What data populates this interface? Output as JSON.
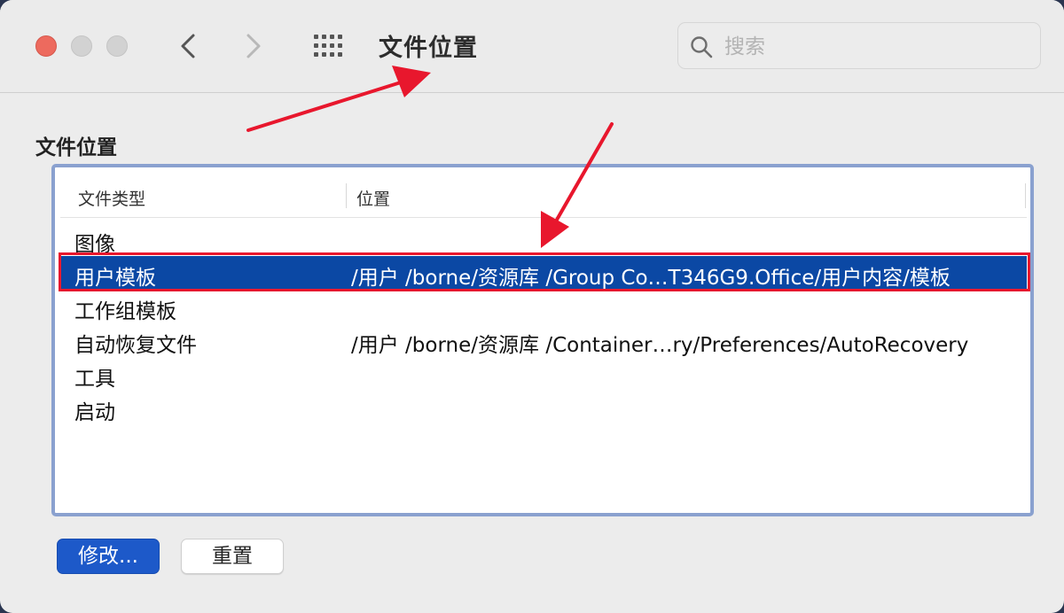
{
  "window": {
    "title": "文件位置"
  },
  "toolbar": {
    "back_icon": "chevron-left-icon",
    "forward_icon": "chevron-right-icon",
    "grid_icon": "show-all-grid-icon"
  },
  "search": {
    "placeholder": "搜索",
    "value": ""
  },
  "section": {
    "label": "文件位置"
  },
  "table": {
    "columns": [
      "文件类型",
      "位置"
    ],
    "rows": [
      {
        "type": "图像",
        "location": ""
      },
      {
        "type": "用户模板",
        "location": "/用户 /borne/资源库 /Group Co…T346G9.Office/用户内容/模板",
        "selected": true
      },
      {
        "type": "工作组模板",
        "location": ""
      },
      {
        "type": "自动恢复文件",
        "location": "/用户 /borne/资源库 /Container…ry/Preferences/AutoRecovery"
      },
      {
        "type": "工具",
        "location": ""
      },
      {
        "type": "启动",
        "location": ""
      }
    ]
  },
  "buttons": {
    "modify": "修改...",
    "reset": "重置"
  },
  "colors": {
    "selection": "#0b48a4",
    "accent_button": "#1d59c9",
    "annotation_red": "#e8172d",
    "table_border": "#8aa1cf"
  }
}
